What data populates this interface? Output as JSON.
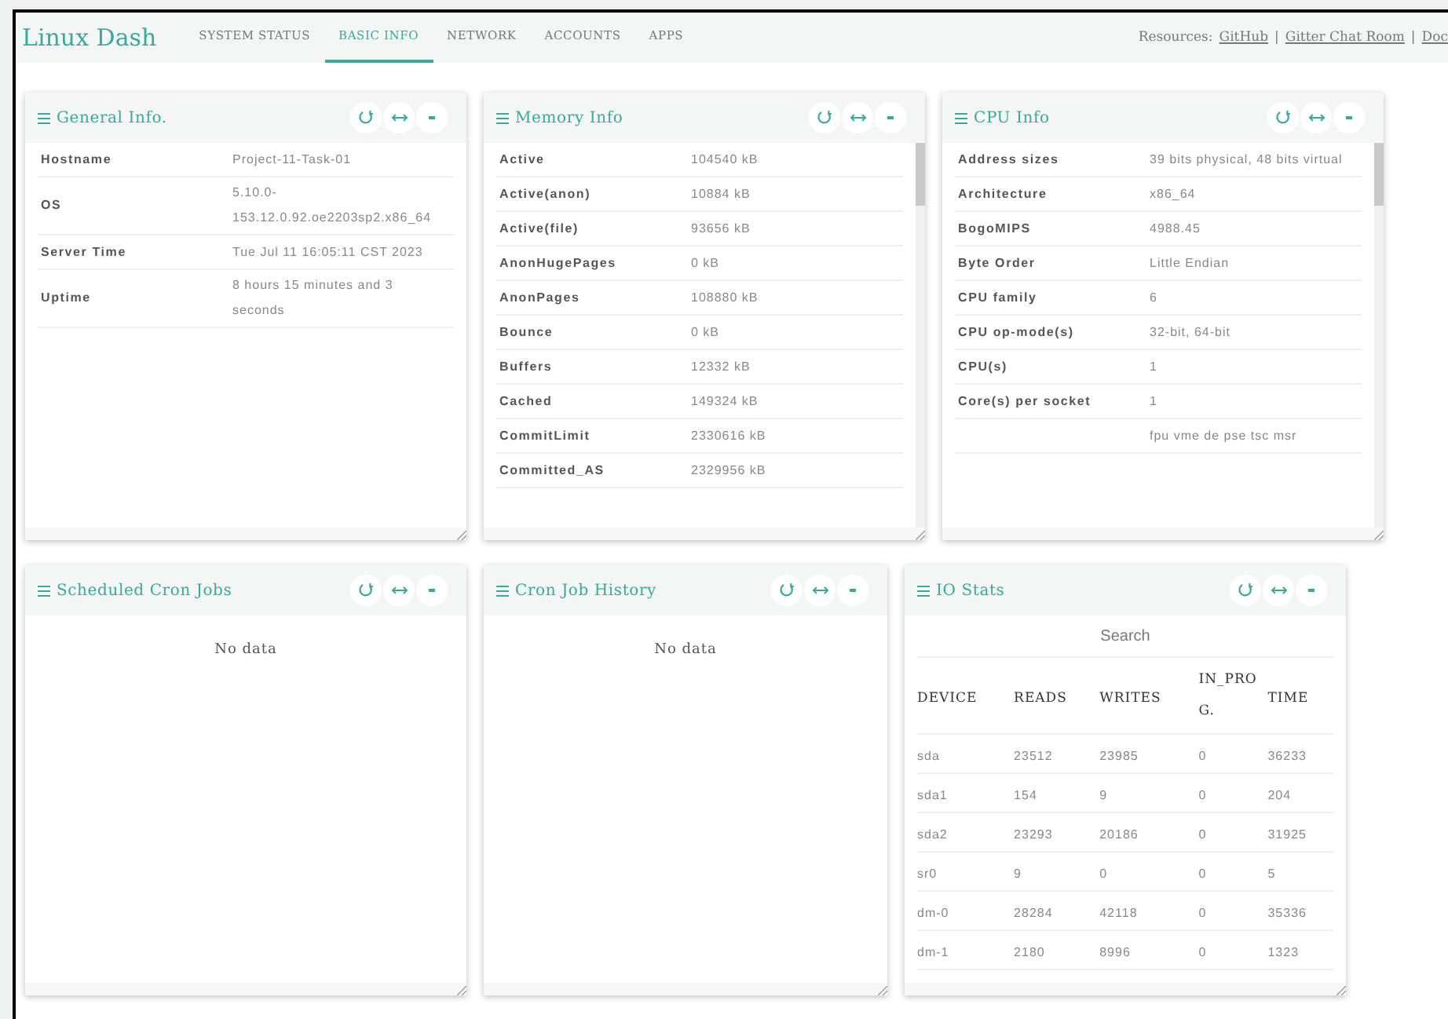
{
  "navbar": {
    "brand": "Linux Dash",
    "tabs": [
      {
        "label": "SYSTEM STATUS",
        "selected": false
      },
      {
        "label": "BASIC INFO",
        "selected": true
      },
      {
        "label": "NETWORK",
        "selected": false
      },
      {
        "label": "ACCOUNTS",
        "selected": false
      },
      {
        "label": "APPS",
        "selected": false
      }
    ],
    "resources": {
      "label": "Resources:",
      "separator": "|",
      "links": [
        "GitHub",
        "Gitter Chat Room",
        "Doc"
      ]
    }
  },
  "rows": [
    [
      {
        "title": "General Info.",
        "kind": "kv",
        "scrollable": false,
        "rows": [
          {
            "key": "Hostname",
            "value": "Project-11-Task-01"
          },
          {
            "key": "OS",
            "value": "5.10.0-153.12.0.92.oe2203sp2.x86_64"
          },
          {
            "key": "Server Time",
            "value": "Tue Jul 11 16:05:11 CST 2023"
          },
          {
            "key": "Uptime",
            "value": "8 hours 15 minutes and 3 seconds"
          }
        ]
      },
      {
        "title": "Memory Info",
        "kind": "kv",
        "scrollable": true,
        "rows": [
          {
            "key": "Active",
            "value": "104540 kB"
          },
          {
            "key": "Active(anon)",
            "value": "10884 kB"
          },
          {
            "key": "Active(file)",
            "value": "93656 kB"
          },
          {
            "key": "AnonHugePages",
            "value": "0 kB"
          },
          {
            "key": "AnonPages",
            "value": "108880 kB"
          },
          {
            "key": "Bounce",
            "value": "0 kB"
          },
          {
            "key": "Buffers",
            "value": "12332 kB"
          },
          {
            "key": "Cached",
            "value": "149324 kB"
          },
          {
            "key": "CommitLimit",
            "value": "2330616 kB"
          },
          {
            "key": "Committed_AS",
            "value": "2329956 kB"
          }
        ]
      },
      {
        "title": "CPU Info",
        "kind": "kv",
        "scrollable": true,
        "rows": [
          {
            "key": "Address sizes",
            "value": "39 bits physical, 48 bits virtual"
          },
          {
            "key": "Architecture",
            "value": "x86_64"
          },
          {
            "key": "BogoMIPS",
            "value": "4988.45"
          },
          {
            "key": "Byte Order",
            "value": "Little Endian"
          },
          {
            "key": "CPU family",
            "value": "6"
          },
          {
            "key": "CPU op-mode(s)",
            "value": "32-bit, 64-bit"
          },
          {
            "key": "CPU(s)",
            "value": "1"
          },
          {
            "key": "Core(s) per socket",
            "value": "1"
          },
          {
            "value": "fpu vme de pse tsc msr"
          }
        ]
      }
    ],
    [
      {
        "title": "Scheduled Cron Jobs",
        "kind": "empty",
        "message": "No data"
      },
      {
        "title": "Cron Job History",
        "kind": "empty",
        "message": "No data"
      },
      {
        "title": "IO Stats",
        "kind": "table",
        "search": {
          "placeholder": "Search"
        },
        "columns": [
          "DEVICE",
          "READS",
          "WRITES",
          "IN_PROG.",
          "TIME"
        ],
        "rows": [
          [
            "sda",
            "23512",
            "23985",
            "0",
            "36233"
          ],
          [
            "sda1",
            "154",
            "9",
            "0",
            "204"
          ],
          [
            "sda2",
            "23293",
            "20186",
            "0",
            "31925"
          ],
          [
            "sr0",
            "9",
            "0",
            "0",
            "5"
          ],
          [
            "dm-0",
            "28284",
            "42118",
            "0",
            "35336"
          ],
          [
            "dm-1",
            "2180",
            "8996",
            "0",
            "1323"
          ]
        ]
      }
    ]
  ]
}
